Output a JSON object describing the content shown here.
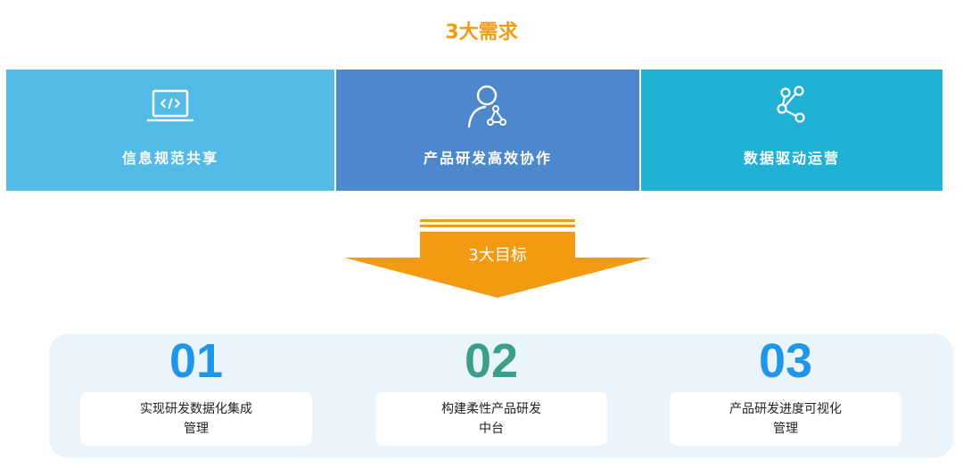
{
  "title": "3大需求",
  "needs": [
    {
      "label": "信息规范共享",
      "icon": "code-laptop-icon",
      "color": "#53bae6"
    },
    {
      "label": "产品研发高效协作",
      "icon": "user-network-icon",
      "color": "#4d87cc"
    },
    {
      "label": "数据驱动运营",
      "icon": "share-nodes-icon",
      "color": "#21b1d4"
    }
  ],
  "arrow": {
    "label": "3大目标",
    "color": "#f39a13"
  },
  "goals": [
    {
      "number": "01",
      "line1": "实现研发数据化集成",
      "line2": "管理",
      "color": "#2196e8"
    },
    {
      "number": "02",
      "line1": "构建柔性产品研发",
      "line2": "中台",
      "color": "#3b9e8a"
    },
    {
      "number": "03",
      "line1": "产品研发进度可视化",
      "line2": "管理",
      "color": "#2196e8"
    }
  ]
}
